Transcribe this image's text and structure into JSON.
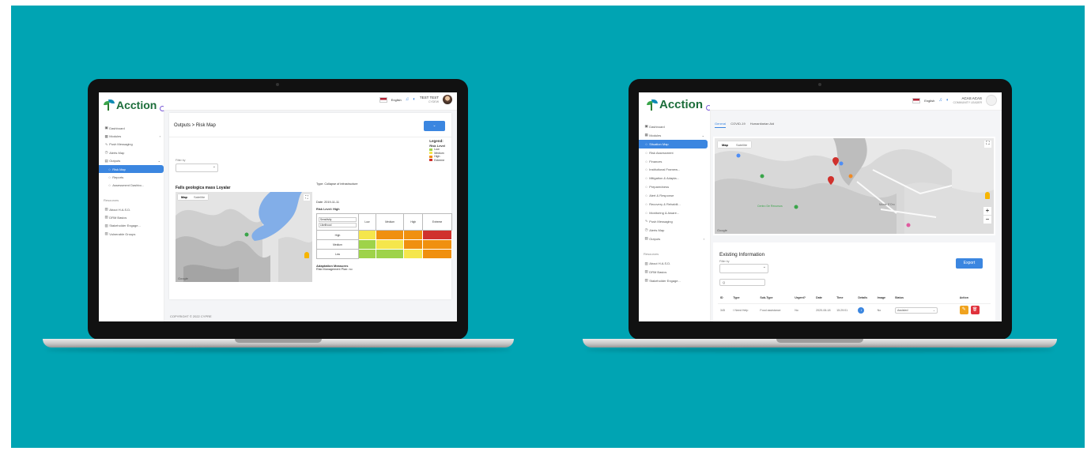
{
  "left": {
    "logo": "Acction",
    "nav": [
      {
        "label": "Dashboard",
        "icon": "dashboard-icon",
        "glyph": "▣"
      },
      {
        "label": "Modules",
        "icon": "modules-icon",
        "glyph": "▦",
        "chevron": "›"
      },
      {
        "label": "Push Messaging",
        "icon": "push-icon",
        "glyph": "∿"
      },
      {
        "label": "Alerts Map",
        "icon": "clock-icon",
        "glyph": "◷"
      },
      {
        "label": "Outputs",
        "icon": "outputs-icon",
        "glyph": "▤",
        "chevron": "⌄"
      },
      {
        "label": "Risk Map",
        "icon": "circle-icon",
        "glyph": "○",
        "active": true,
        "sub": true
      },
      {
        "label": "Reports",
        "icon": "circle-icon",
        "glyph": "○",
        "sub": true
      },
      {
        "label": "Assessment Dashbo...",
        "icon": "circle-icon",
        "glyph": "○",
        "sub": true
      }
    ],
    "nav_heading": "Resources",
    "resources": [
      {
        "label": "About H.A.S.D.",
        "icon": "book-icon",
        "glyph": "▥"
      },
      {
        "label": "DRM Basics",
        "icon": "book-icon",
        "glyph": "▥"
      },
      {
        "label": "Stakeholder Engage...",
        "icon": "book-icon",
        "glyph": "▥"
      },
      {
        "label": "Vulnerable Groups",
        "icon": "book-icon",
        "glyph": "▥"
      }
    ],
    "topbar": {
      "language": "English",
      "user_name": "TEST TEST",
      "user_role": "CYDEW"
    },
    "page_title": "Outputs > Risk Map",
    "action_button": "⌄",
    "filter": {
      "label": "Filter by",
      "value": ""
    },
    "legend": {
      "title": "Legend:",
      "subtitle": "Risk Level",
      "items": [
        {
          "label": "Low",
          "color": "#9ed34a"
        },
        {
          "label": "Medium",
          "color": "#f5e64c"
        },
        {
          "label": "High",
          "color": "#f0900f"
        },
        {
          "label": "Extreme",
          "color": "#d0312d"
        }
      ]
    },
    "map_title": "Falls geologica mass Loyalar",
    "map_tabs": [
      "Map",
      "Satellite"
    ],
    "map_footer": "Google",
    "info": {
      "type": "Type: Collapse of infrastructure",
      "date": "Date: 2019-11-11",
      "risk_level": "Risk Level: High",
      "adaptation_title": "Adaptation Measures",
      "adaptation_text": "Risk Management Plan: no"
    },
    "matrix": {
      "col_header": "Sensitivity",
      "row_header": "Likelihood",
      "columns": [
        "Low",
        "Medium",
        "High",
        "Extreme"
      ],
      "rows": [
        {
          "label": "High",
          "cells": [
            "#f5e64c",
            "#f0900f",
            "#f0900f",
            "#d0312d"
          ]
        },
        {
          "label": "Medium",
          "cells": [
            "#9ed34a",
            "#f5e64c",
            "#f0900f",
            "#f0900f"
          ]
        },
        {
          "label": "Low",
          "cells": [
            "#9ed34a",
            "#9ed34a",
            "#f5e64c",
            "#f0900f"
          ]
        }
      ]
    },
    "copyright": "COPYRIGHT © 2022 CYPRE"
  },
  "right": {
    "logo": "Acction",
    "nav": [
      {
        "label": "Dashboard",
        "icon": "dashboard-icon",
        "glyph": "▣"
      },
      {
        "label": "Modules",
        "icon": "modules-icon",
        "glyph": "▦",
        "chevron": "⌄"
      },
      {
        "label": "Situation Map",
        "icon": "circle-icon",
        "glyph": "○",
        "active": true
      },
      {
        "label": "Risk Assessment",
        "icon": "circle-icon",
        "glyph": "○"
      },
      {
        "label": "Finances",
        "icon": "circle-icon",
        "glyph": "○"
      },
      {
        "label": "Institutional Framew...",
        "icon": "circle-icon",
        "glyph": "○"
      },
      {
        "label": "Mitigation & Adapta...",
        "icon": "circle-icon",
        "glyph": "○"
      },
      {
        "label": "Preparedness",
        "icon": "circle-icon",
        "glyph": "○"
      },
      {
        "label": "Alert & Response",
        "icon": "circle-icon",
        "glyph": "○"
      },
      {
        "label": "Recovery & Rehabili...",
        "icon": "circle-icon",
        "glyph": "○"
      },
      {
        "label": "Monitoring & Aware...",
        "icon": "circle-icon",
        "glyph": "○"
      },
      {
        "label": "Push Messaging",
        "icon": "push-icon",
        "glyph": "∿"
      },
      {
        "label": "Alerts Map",
        "icon": "clock-icon",
        "glyph": "◷"
      },
      {
        "label": "Outputs",
        "icon": "outputs-icon",
        "glyph": "▤",
        "chevron": "›"
      }
    ],
    "nav_heading": "Resources",
    "resources": [
      {
        "label": "About H.A.S.D.",
        "icon": "book-icon",
        "glyph": "▥"
      },
      {
        "label": "DRM Basics",
        "icon": "book-icon",
        "glyph": "▥"
      },
      {
        "label": "Stakeholder Engage...",
        "icon": "book-icon",
        "glyph": "▥"
      }
    ],
    "topbar": {
      "language": "English",
      "user_name": "ACAS ACAS",
      "user_role": "COMMUNITY LEADER"
    },
    "tabs": [
      "General",
      "COVID-19",
      "Humanitarian Aid"
    ],
    "map_tabs": [
      "Map",
      "Satellite"
    ],
    "map_footer": "Google",
    "map_labels": [
      "Monte D'Oro",
      "Centro De Recursos"
    ],
    "section_title": "Existing Information",
    "filter": {
      "label": "Filter by",
      "value": ""
    },
    "export_label": "Export",
    "search_value": "Q",
    "table": {
      "columns": [
        "ID",
        "Type",
        "Sub-Type",
        "Urgent?",
        "Date",
        "Time",
        "Details",
        "Image",
        "Status",
        "Action"
      ],
      "rows": [
        {
          "id": "345",
          "type": "I Need Help",
          "subtype": "Food assistance",
          "urgent": "No",
          "date": "2020-06-18",
          "time": "15:29:01",
          "details": "i",
          "image": "No",
          "status": "Assisted",
          "status_chevron": "⌄",
          "edit": "✎",
          "delete": "🗑"
        }
      ]
    }
  }
}
